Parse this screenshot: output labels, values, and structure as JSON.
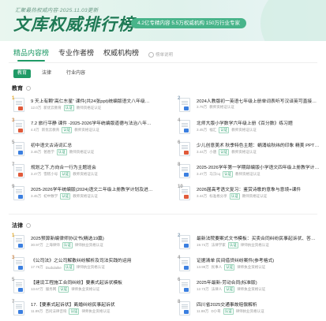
{
  "banner": {
    "subtitle": "汇聚最热权威内容·2025.11.03更新",
    "title": "文库权威排行榜",
    "tag": "4.2亿专精内容 5.5万权威机构 150万行业专家"
  },
  "tabs": [
    {
      "label": "精品内容榜",
      "active": true
    },
    {
      "label": "专业作者榜",
      "active": false
    },
    {
      "label": "权威机构榜",
      "active": false
    }
  ],
  "help": {
    "label": "榜单说明"
  },
  "chips": [
    {
      "label": "教育",
      "active": true
    },
    {
      "label": "法律",
      "active": false
    },
    {
      "label": "行业内容",
      "active": false
    }
  ],
  "sections": [
    {
      "title": "教育",
      "items": [
        {
          "rank": "1",
          "title": "9 天上有颗“高仁东星” 课件(共24张ppt)统编版语文八年级…",
          "meta1": "12.0万",
          "meta2": "新优云教育",
          "badge": "认证",
          "src": "教师资格证认证",
          "fmt": "#e05a3a"
        },
        {
          "rank": "2",
          "title": "2024人教版初一英语七年级上册单词表听写汉译英可直接下…",
          "meta1": "3.79万",
          "meta2": "教师资格证认证",
          "badge": "",
          "src": "",
          "fmt": "#3b7fe0"
        },
        {
          "rank": "3",
          "title": "7.2 旅行平静 课件 -2025-2026学年统编版道德与法治八年…",
          "meta1": "4.0万",
          "meta2": "新优云教育",
          "badge": "认证",
          "src": "教师资格证认证",
          "fmt": "#e05a3a"
        },
        {
          "rank": "4",
          "title": "北师大版小学数学六年级上册《百分数》练习题",
          "meta1": "3.45万",
          "meta2": "福汇",
          "badge": "认证",
          "src": "教师资格证认证",
          "fmt": "#3b7fe0"
        },
        {
          "rank": "5",
          "title": "初中语文古诗词汇总",
          "meta1": "3.46万",
          "meta2": "爸爸学",
          "badge": "认证",
          "src": "教师资格证认证",
          "fmt": "#3b7fe0"
        },
        {
          "rank": "6",
          "title": "少儿创意美术 秋季特色主题：蜗涌绘秋纬的印象 精美 PPT课…",
          "meta1": "3.44万",
          "meta2": "小唐",
          "badge": "认证",
          "src": "教师资格证认证",
          "fmt": "#e05a3a"
        },
        {
          "rank": "7",
          "title": "规划之下,方向合一行为主题班会",
          "meta1": "3.47万",
          "meta2": "雪糕小号",
          "badge": "认证",
          "src": "教师资格证认证",
          "fmt": "#e05a3a"
        },
        {
          "rank": "8",
          "title": "2025-2026学年第一学期部编版小学语文四年级上册教学计…",
          "meta1": "3.47万",
          "meta2": "马汉cq",
          "badge": "认证",
          "src": "教师资格证认证",
          "fmt": "#3b7fe0"
        },
        {
          "rank": "9",
          "title": "2025-2026学年统编版(2024)语文二年级上册教学计划及进…",
          "meta1": "3.45万",
          "meta2": "初中数学",
          "badge": "认证",
          "src": "教师资格证认证",
          "fmt": "#3b7fe0"
        },
        {
          "rank": "10",
          "title": "2026届高考语文复习：鉴赏诗歌的意象与意境+课件",
          "meta1": "3.44万",
          "meta2": "标准格分享",
          "badge": "认证",
          "src": "教师资格证认证",
          "fmt": "#e05a3a"
        }
      ]
    },
    {
      "title": "法律",
      "items": [
        {
          "rank": "1",
          "title": "2025预算新编律师协议书(精选19篇)",
          "meta1": "30.97万",
          "meta2": "上海律师",
          "badge": "认证",
          "src": "律师执业资格认证",
          "fmt": "#3b7fe0"
        },
        {
          "rank": "2",
          "title": "最新法院要案式文书模板：买卖合同纠纷民事起诉状、答辩…",
          "meta1": "19.74万",
          "meta2": "法律学家",
          "badge": "认证",
          "src": "律师执业资格认证",
          "fmt": "#3b7fe0"
        },
        {
          "rank": "3",
          "title": "《公司法》之公司解散纠纷解析及司法实践的运用",
          "meta1": "17.76万",
          "meta2": "Dudulaike",
          "badge": "认证",
          "src": "律师执业资格认证",
          "fmt": "#3b7fe0"
        },
        {
          "rank": "4",
          "title": "证据清单 民间借贷纠纷案件(参考格式)",
          "meta1": "13.99万",
          "meta2": "民事人",
          "badge": "认证",
          "src": "律师执业资格认证",
          "fmt": "#3b7fe0"
        },
        {
          "rank": "5",
          "title": "【建设工程施工合同纠纷】要素式起诉状模板",
          "meta1": "13.67万",
          "meta2": "服务网",
          "badge": "认证",
          "src": "律师执业资格认证",
          "fmt": "#3b7fe0"
        },
        {
          "rank": "6",
          "title": "2025年最新-劳动合同(标准版)",
          "meta1": "12.73万",
          "meta2": "法律人",
          "badge": "认证",
          "src": "律师执业资格认证",
          "fmt": "#3b7fe0"
        },
        {
          "rank": "7",
          "title": "17.【要素式起诉状】离婚纠纷民事起诉状",
          "meta1": "11.89万",
          "meta2": "百问法律咨询",
          "badge": "认证",
          "src": "律师执业资格认证",
          "fmt": "#3b7fe0"
        },
        {
          "rank": "8",
          "title": "四川省2025交通事故赔偿解析",
          "meta1": "11.88万",
          "meta2": "D小哥",
          "badge": "认证",
          "src": "律师执业资格认证",
          "fmt": "#3b7fe0"
        }
      ]
    }
  ],
  "colors": {
    "accent": "#1f9a66",
    "banner_title": "#1f7a55",
    "gold": "#e0a21a"
  }
}
